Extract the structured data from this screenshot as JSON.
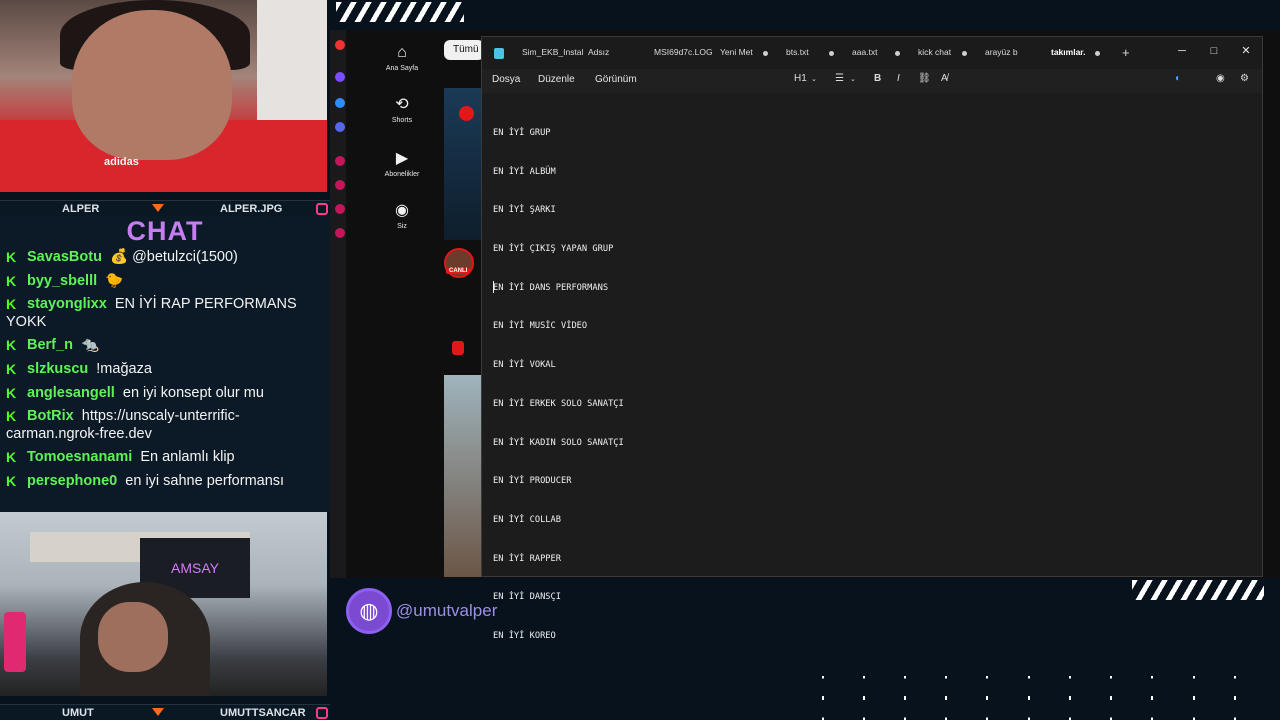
{
  "overlay": {
    "top_cam": {
      "name_left": "ALPER",
      "name_right": "ALPER.JPG",
      "shirt_logo": "adidas"
    },
    "bottom_cam": {
      "name_left": "UMUT",
      "name_right": "UMUTTSANCAR",
      "banner": "AMSAY"
    },
    "social_handle": "@umutvalper"
  },
  "chat": {
    "title": "CHAT",
    "messages": [
      {
        "user": "SavasBotu",
        "text": "💰 @betulzci(1500)"
      },
      {
        "user": "byy_sbelll",
        "text": "🐤"
      },
      {
        "user": "stayonglixx",
        "text": "EN İYİ RAP PERFORMANS YOKK"
      },
      {
        "user": "Berf_n",
        "text": "🐀"
      },
      {
        "user": "slzkuscu",
        "text": "!mağaza"
      },
      {
        "user": "anglesangell",
        "text": "en iyi konsept olur mu"
      },
      {
        "user": "BotRix",
        "text": "https://unscaly-unterrific-carman.ngrok-free.dev"
      },
      {
        "user": "Tomoesnanami",
        "text": "En anlamlı klip"
      },
      {
        "user": "persephone0",
        "text": "en iyi sahne performansı"
      }
    ]
  },
  "youtube": {
    "sidebar": [
      {
        "label": "Ana Sayfa",
        "icon": "home-icon",
        "glyph": "⌂"
      },
      {
        "label": "Shorts",
        "icon": "shorts-icon",
        "glyph": "⟲"
      },
      {
        "label": "Abonelikler",
        "icon": "subscriptions-icon",
        "glyph": "▶"
      },
      {
        "label": "Siz",
        "icon": "account-icon",
        "glyph": "◉"
      }
    ],
    "chip": "Tümü",
    "live_label": "CANLI"
  },
  "notepad": {
    "tabs": [
      {
        "label": "Sim_EKB_Instal"
      },
      {
        "label": "Adsız"
      },
      {
        "label": "MSI69d7c.LOG"
      },
      {
        "label": "Yeni Met"
      },
      {
        "label": "bts.txt"
      },
      {
        "label": "aaa.txt"
      },
      {
        "label": "kick chat"
      },
      {
        "label": "arayüz b"
      },
      {
        "label": "takımlar."
      }
    ],
    "new_tab": "+",
    "window": {
      "minimize": "─",
      "maximize": "□",
      "close": "✕"
    },
    "menu": [
      "Dosya",
      "Düzenle",
      "Görünüm"
    ],
    "format": {
      "heading": "H1",
      "list": "☰",
      "bold": "B",
      "italic": "I",
      "link": "⛓",
      "clear": "A̸"
    },
    "lines": [
      "EN İYİ GRUP",
      "EN İYİ ALBÜM",
      "EN İYİ ŞARKI",
      "EN İYİ ÇIKIŞ YAPAN GRUP",
      "EN İYİ DANS PERFORMANS",
      "EN İYİ MUSİC VİDEO",
      "EN İYİ VOKAL",
      "EN İYİ ERKEK SOLO SANATÇI",
      "EN İYİ KADIN SOLO SANATÇI",
      "EN İYİ PRODUCER",
      "EN İYİ COLLAB",
      "EN İYİ RAPPER",
      "EN İYİ DANSÇI",
      "EN İYİ KOREO"
    ]
  },
  "colors": {
    "chat_title": "#c67df0",
    "chat_user": "#5ff258",
    "kick_badge": "#53fc18",
    "accent_orange": "#ff6a1a",
    "handle": "#9d8fe6"
  }
}
